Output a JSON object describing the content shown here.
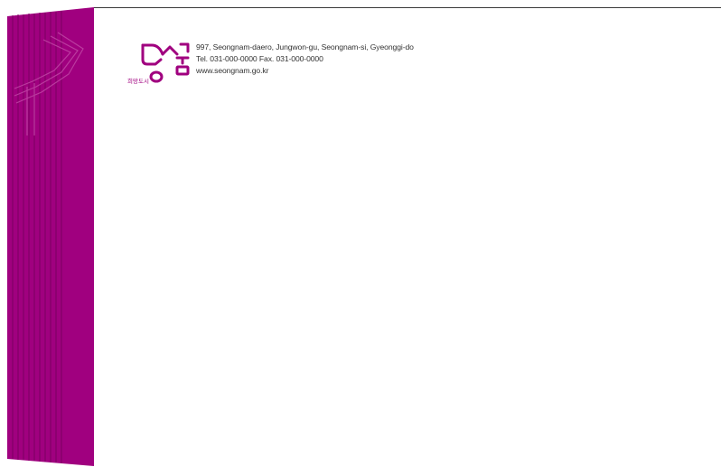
{
  "brand": {
    "slogan": "희망도시",
    "name": "성남",
    "accent_color": "#a0007f"
  },
  "address": {
    "street": "997, Seongnam-daero, Jungwon-gu, Seongnam-si, Gyeonggi-do",
    "phone_line": "Tel. 031-000-0000   Fax. 031-000-0000",
    "website": "www.seongnam.go.kr"
  }
}
